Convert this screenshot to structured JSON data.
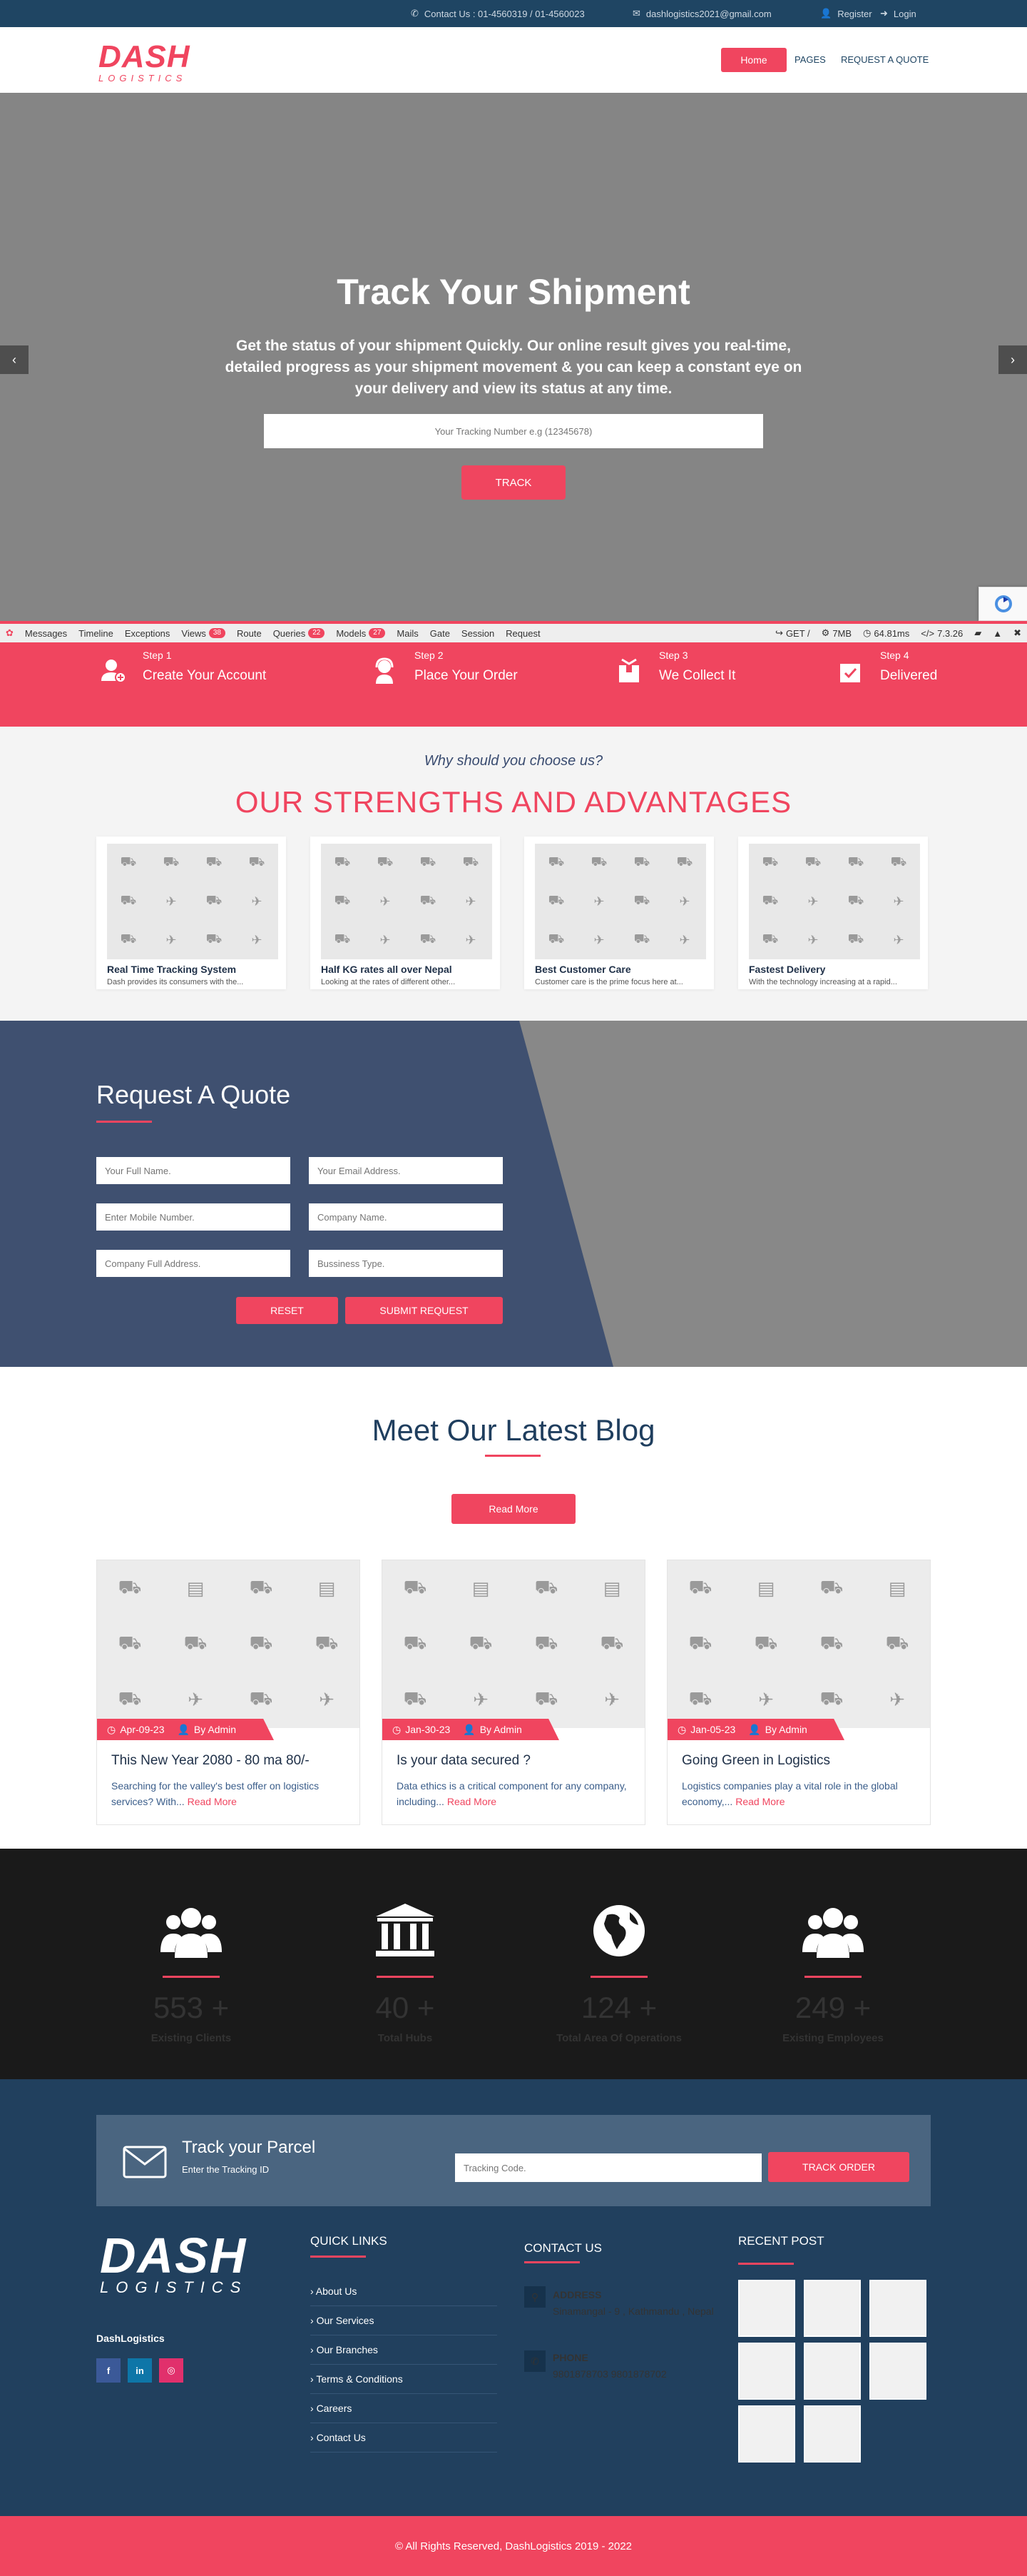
{
  "topbar": {
    "contact": "Contact Us : 01-4560319 / 01-4560023",
    "email": "dashlogistics2021@gmail.com",
    "register": "Register",
    "login": "Login"
  },
  "header": {
    "logo_main": "DASH",
    "logo_sub": "LOGISTICS",
    "nav": [
      "Home",
      "PAGES",
      "REQUEST A QUOTE"
    ]
  },
  "hero": {
    "title": "Track Your Shipment",
    "description": "Get the status of your shipment Quickly. Our online result gives you real-time, detailed progress as your shipment movement & you can keep a constant eye on your delivery and view its status at any time.",
    "input_placeholder": "Your Tracking Number e.g (12345678)",
    "button": "TRACK",
    "prev": "‹",
    "next": "›"
  },
  "debugbar": {
    "items": [
      "Messages",
      "Timeline",
      "Exceptions",
      "Views",
      "Route",
      "Queries",
      "Models",
      "Mails",
      "Gate",
      "Session",
      "Request"
    ],
    "views_count": "38",
    "queries_count": "22",
    "models_count": "27",
    "method": "GET /",
    "memory": "7MB",
    "time": "64.81ms",
    "php": "7.3.26"
  },
  "steps": [
    {
      "num": "Step 1",
      "title": "Create Your Account",
      "icon": "user-plus-icon"
    },
    {
      "num": "Step 2",
      "title": "Place Your Order",
      "icon": "headset-icon"
    },
    {
      "num": "Step 3",
      "title": "We Collect It",
      "icon": "box-icon"
    },
    {
      "num": "Step 4",
      "title": "Delivered",
      "icon": "delivered-box-icon"
    }
  ],
  "strengths": {
    "eyebrow": "Why should you choose us?",
    "title": "OUR STRENGTHS AND ADVANTAGES",
    "cards": [
      {
        "title": "Real Time Tracking System",
        "text": "Dash provides its consumers with the..."
      },
      {
        "title": "Half KG rates all over Nepal",
        "text": "Looking at the rates of different other..."
      },
      {
        "title": "Best Customer Care",
        "text": "Customer care is the prime focus here at..."
      },
      {
        "title": "Fastest Delivery",
        "text": "With the technology increasing at a rapid..."
      }
    ]
  },
  "quote": {
    "title": "Request A Quote",
    "fields": [
      "Your Full Name.",
      "Your Email Address.",
      "Enter Mobile Number.",
      "Company Name.",
      "Company Full Address.",
      "Bussiness Type."
    ],
    "reset": "RESET",
    "submit": "SUBMIT REQUEST"
  },
  "blog": {
    "title": "Meet Our Latest Blog",
    "read_more_button": "Read More",
    "posts": [
      {
        "date": "Apr-09-23",
        "author": "By Admin",
        "title": "This New Year 2080 - 80 ma 80/-",
        "text": "Searching for the valley's best offer on logistics services? With...",
        "link": "Read More"
      },
      {
        "date": "Jan-30-23",
        "author": "By Admin",
        "title": "Is your data secured ?",
        "text": "Data ethics is a critical component for any company, including...",
        "link": "Read More"
      },
      {
        "date": "Jan-05-23",
        "author": "By Admin",
        "title": "Going Green in Logistics",
        "text": "Logistics companies play a vital role in the global economy,...",
        "link": "Read More"
      }
    ]
  },
  "stats": [
    {
      "value": "553 +",
      "label": "Existing Clients",
      "icon": "users-icon"
    },
    {
      "value": "40 +",
      "label": "Total Hubs",
      "icon": "building-icon"
    },
    {
      "value": "124 +",
      "label": "Total Area Of Operations",
      "icon": "globe-icon"
    },
    {
      "value": "249 +",
      "label": "Existing Employees",
      "icon": "users-icon"
    }
  ],
  "footer": {
    "parcel_title": "Track your Parcel",
    "parcel_sub": "Enter the Tracking ID",
    "parcel_placeholder": "Tracking Code.",
    "parcel_button": "TRACK ORDER",
    "brand": "DashLogistics",
    "quick_links_title": "QUICK LINKS",
    "quick_links": [
      "About Us",
      "Our Services",
      "Our Branches",
      "Terms & Conditions",
      "Careers",
      "Contact Us"
    ],
    "contact_title": "CONTACT US",
    "address_label": "ADDRESS",
    "address": "Sinamangal - 9 , Kathmandu , Nepal",
    "phone_label": "PHONE",
    "phone": "9801878703  9801878702",
    "recent_title": "RECENT POST",
    "copyright": "© All Rights Reserved, DashLogistics 2019 - 2022"
  },
  "colors": {
    "accent": "#f0455f",
    "navy": "#1f4563",
    "dark": "#1a1a1a"
  }
}
